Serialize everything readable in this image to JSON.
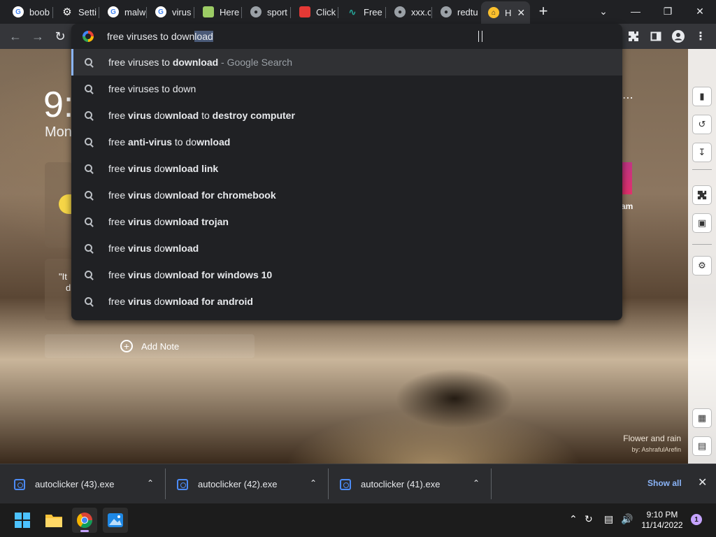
{
  "tabs": [
    {
      "label": "boob",
      "favicon": "google-icon",
      "color": "#ffffff"
    },
    {
      "label": "Setti",
      "favicon": "gear-icon",
      "color": "#ffffff"
    },
    {
      "label": "malw",
      "favicon": "google-icon",
      "color": "#ffffff"
    },
    {
      "label": "virus",
      "favicon": "google-icon",
      "color": "#ffffff"
    },
    {
      "label": "Here",
      "favicon": "site-icon",
      "color": "#9ccc65"
    },
    {
      "label": "sport",
      "favicon": "globe-icon",
      "color": "#9aa0a6"
    },
    {
      "label": "Click",
      "favicon": "site-icon",
      "color": "#e53935"
    },
    {
      "label": "Free",
      "favicon": "wave-icon",
      "color": "#26a69a"
    },
    {
      "label": "xxx.c",
      "favicon": "globe-icon",
      "color": "#9aa0a6"
    },
    {
      "label": "redtu",
      "favicon": "globe-icon",
      "color": "#9aa0a6"
    },
    {
      "label": "H",
      "favicon": "home-icon",
      "color": "#fbc02d",
      "active": true
    }
  ],
  "omnibox": {
    "text_plain": "free viruses to down",
    "text_selected": "load",
    "suggestions": [
      {
        "parts": [
          [
            "free viruses to ",
            false
          ],
          [
            "download",
            true
          ]
        ],
        "suffix": " - Google Search",
        "highlighted": true
      },
      {
        "parts": [
          [
            "free viruses to down",
            false
          ]
        ]
      },
      {
        "parts": [
          [
            "free ",
            false
          ],
          [
            "virus",
            true
          ],
          [
            " do",
            false
          ],
          [
            "wnload",
            true
          ],
          [
            " to ",
            false
          ],
          [
            "destroy computer",
            true
          ]
        ]
      },
      {
        "parts": [
          [
            "free ",
            false
          ],
          [
            "anti-virus",
            true
          ],
          [
            " to do",
            false
          ],
          [
            "wnload",
            true
          ]
        ]
      },
      {
        "parts": [
          [
            "free ",
            false
          ],
          [
            "virus",
            true
          ],
          [
            " do",
            false
          ],
          [
            "wnload link",
            true
          ]
        ]
      },
      {
        "parts": [
          [
            "free ",
            false
          ],
          [
            "virus",
            true
          ],
          [
            " do",
            false
          ],
          [
            "wnload for chromebook",
            true
          ]
        ]
      },
      {
        "parts": [
          [
            "free ",
            false
          ],
          [
            "virus",
            true
          ],
          [
            " do",
            false
          ],
          [
            "wnload trojan",
            true
          ]
        ]
      },
      {
        "parts": [
          [
            "free ",
            false
          ],
          [
            "virus",
            true
          ],
          [
            " do",
            false
          ],
          [
            "wnload",
            true
          ]
        ]
      },
      {
        "parts": [
          [
            "free ",
            false
          ],
          [
            "virus",
            true
          ],
          [
            " do",
            false
          ],
          [
            "wnload for windows 10",
            true
          ]
        ]
      },
      {
        "parts": [
          [
            "free ",
            false
          ],
          [
            "virus",
            true
          ],
          [
            " do",
            false
          ],
          [
            "wnload for android",
            true
          ]
        ]
      }
    ]
  },
  "newtab": {
    "clock": "9:",
    "day": "Mon",
    "quote": "\"It",
    "add_note": "Add Note",
    "instagram_label": "am",
    "photo_title": "Flower and rain",
    "photo_credit": "by: AshrafulArefin"
  },
  "downloads": {
    "items": [
      "autoclicker (43).exe",
      "autoclicker (42).exe",
      "autoclicker (41).exe"
    ],
    "show_all": "Show all"
  },
  "taskbar": {
    "time": "9:10 PM",
    "date": "11/14/2022",
    "notifications": "1"
  }
}
